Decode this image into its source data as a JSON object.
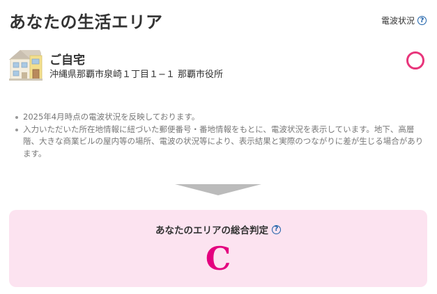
{
  "header": {
    "title": "あなたの生活エリア",
    "signal_link_label": "電波状況",
    "help_icon": "question-circle-icon"
  },
  "home": {
    "icon": "house-icon",
    "name": "ご自宅",
    "address": "沖縄県那覇市泉崎１丁目１−１ 那覇市役所",
    "status_icon": "pink-circle-icon"
  },
  "notes": [
    "2025年4月時点の電波状況を反映しております。",
    "入力いただいた所在地情報に紐づいた郵便番号・番地情報をもとに、電波状況を表示しています。地下、高層階、大きな商業ビルの屋内等の場所、電波の状況等により、表示結果と実際のつながりに差が生じる場合があります。"
  ],
  "result": {
    "label": "あなたのエリアの総合判定",
    "help_icon": "question-circle-icon",
    "grade": "C"
  },
  "colors": {
    "accent_pink": "#e4007f",
    "ring_pink": "#e8357b",
    "card_bg": "#fce3f0",
    "help_blue": "#1a5fa8",
    "arrow_gray": "#bbbbbb"
  }
}
